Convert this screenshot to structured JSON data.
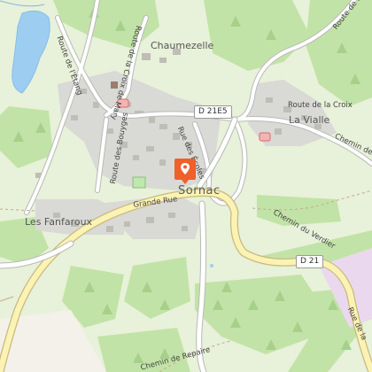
{
  "map": {
    "places": {
      "chaumezelle": "Chaumezelle",
      "la_vialle": "La Vialle",
      "sornac": "Sornac",
      "les_fanfaroux": "Les Fanfaroux"
    },
    "roads": {
      "route_etang": "Route de l'Étang",
      "route_croix_mary": "Route de la Croix de Mary",
      "route_vialle_top": "Route de la Vialle",
      "route_ecoles": "Rue des Écoles",
      "route_croix": "Route de la Croix",
      "chemin_des": "Chemin des",
      "route_bouyges": "Route des Bouyges",
      "grande_rue": "Grande Rue",
      "chemin_verdier": "Chemin du Verdier",
      "rue_la": "Rue de la",
      "chemin_repaire": "Chemin de Repaire"
    },
    "shields": {
      "d21e5": "D 21E5",
      "d21": "D 21"
    },
    "icons": {
      "marker": "location-pin-icon",
      "fuel": "fuel-icon",
      "church": "church-icon"
    },
    "colors": {
      "background": "#e8f1d9",
      "forest": "#bfe0a4",
      "water": "#9ecdf2",
      "road_major": "#fbf3b4",
      "road_outline": "#c9b97c",
      "road_minor": "#ffffff",
      "built": "#d8d8d8",
      "marker": "#f0602a"
    }
  }
}
